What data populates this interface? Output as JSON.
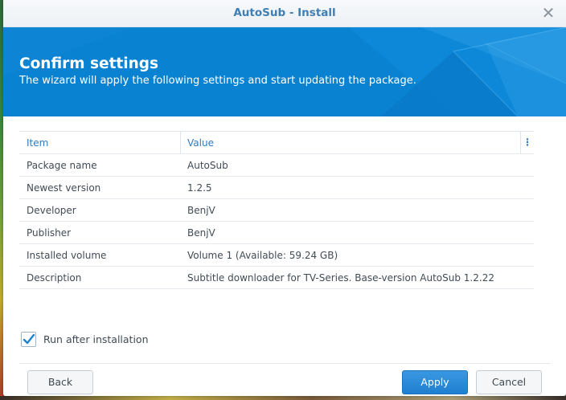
{
  "window": {
    "title": "AutoSub - Install",
    "close_icon": "close-icon"
  },
  "banner": {
    "title": "Confirm settings",
    "subtitle": "The wizard will apply the following settings and start updating the package."
  },
  "table": {
    "headers": [
      "Item",
      "Value"
    ],
    "column_menu_icon": "⋮",
    "rows": [
      [
        "Package name",
        "AutoSub"
      ],
      [
        "Newest version",
        "1.2.5"
      ],
      [
        "Developer",
        "BenjV"
      ],
      [
        "Publisher",
        "BenjV"
      ],
      [
        "Installed volume",
        "Volume 1 (Available: 59.24 GB)"
      ],
      [
        "Description",
        "Subtitle downloader for TV-Series. Base-version AutoSub 1.2.22"
      ]
    ]
  },
  "options": {
    "run_after_label": "Run after installation",
    "run_after_checked": true
  },
  "buttons": {
    "back": "Back",
    "apply": "Apply",
    "cancel": "Cancel"
  },
  "colors": {
    "accent": "#0a82d2",
    "title": "#3f7fb3",
    "header_text": "#2f7bbf",
    "apply_button": "#1f7fd0"
  }
}
